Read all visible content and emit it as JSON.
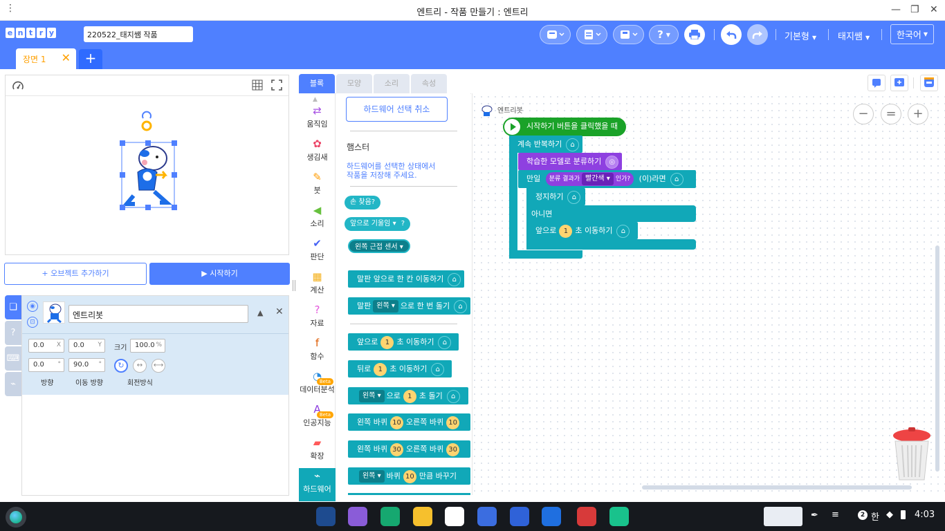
{
  "window": {
    "menu_glyph": "⋮",
    "title": "엔트리 - 작품 만들기 : 엔트리",
    "minimize": "—",
    "restore": "❐",
    "close": "✕"
  },
  "header": {
    "logo": [
      "e",
      "n",
      "t",
      "r",
      "y"
    ],
    "project_name": "220522_태지쌤 작품",
    "help": "?",
    "mode": "기본형",
    "user": "태지쌤",
    "language": "한국어",
    "scene_tab": "장면 1",
    "scene_close": "✕",
    "add_scene": "+"
  },
  "stage": {
    "add_object": "+ 오브젝트 추가하기",
    "start": "▶ 시작하기"
  },
  "object": {
    "name": "엔트리봇",
    "x": "0.0",
    "x_unit": "X",
    "y": "0.0",
    "y_unit": "Y",
    "size_label": "크기",
    "size": "100.0",
    "size_unit": "%",
    "direction": "0.0",
    "direction_unit": "°",
    "move_direction": "90.0",
    "move_direction_unit": "°",
    "direction_label": "방향",
    "move_direction_label": "이동 방향",
    "rotation_label": "회전방식"
  },
  "block_tabs": [
    "블록",
    "모양",
    "소리",
    "속성"
  ],
  "categories": [
    {
      "label": "움직임",
      "icon": "⇄",
      "color": "#a751e3"
    },
    {
      "label": "생김새",
      "icon": "✿",
      "color": "#ec4466"
    },
    {
      "label": "붓",
      "icon": "✎",
      "color": "#ff9b00"
    },
    {
      "label": "소리",
      "icon": "◀",
      "color": "#67c13e"
    },
    {
      "label": "판단",
      "icon": "✔",
      "color": "#4562f5"
    },
    {
      "label": "계산",
      "icon": "▦",
      "color": "#f4af18"
    },
    {
      "label": "자료",
      "icon": "?",
      "color": "#e457dc"
    },
    {
      "label": "함수",
      "icon": "f",
      "color": "#de5c04"
    },
    {
      "label": "데이터분석",
      "icon": "◔",
      "color": "#2b8de0",
      "beta": "Beta"
    },
    {
      "label": "인공지능",
      "icon": "A",
      "color": "#8e40e0",
      "beta": "Beta"
    },
    {
      "label": "확장",
      "icon": "▰",
      "color": "#ff5a5a"
    },
    {
      "label": "하드웨어",
      "icon": "⌁",
      "color": "#ffffff"
    }
  ],
  "palette": {
    "hw_cancel": "하드웨어 선택 취소",
    "device": "햄스터",
    "hint": "하드웨어를 선택한 상태에서 작품을 저장해 주세요.",
    "b_hand": "손 찾음?",
    "b_tilt": "앞으로 기울임",
    "b_tilt_q": "?",
    "b_prox": "왼쪽 근접 센서",
    "b_board_fwd": "말판 앞으로 한 칸 이동하기",
    "b_board_turn_pre": "말판",
    "b_board_turn_dd": "왼쪽",
    "b_board_turn_post": "으로 한 번 돌기",
    "b_fwd_pre": "앞으로",
    "b_fwd_num": "1",
    "b_fwd_post": "초 이동하기",
    "b_back_pre": "뒤로",
    "b_back_num": "1",
    "b_back_post": "초 이동하기",
    "b_turn_dd": "왼쪽",
    "b_turn_mid": "으로",
    "b_turn_num": "1",
    "b_turn_post": "초 돌기",
    "b_w1_pre": "왼쪽 바퀴",
    "b_w1_n1": "10",
    "b_w1_mid": "오른쪽 바퀴",
    "b_w1_n2": "10",
    "b_w2_pre": "왼쪽 바퀴",
    "b_w2_n1": "30",
    "b_w2_mid": "오른쪽 바퀴",
    "b_w2_n2": "30",
    "b_w3_dd": "왼쪽",
    "b_w3_mid": "바퀴",
    "b_w3_num": "10",
    "b_w3_post": "만큼 바꾸기"
  },
  "script": {
    "object_label": "엔트리봇",
    "when_start": "시작하기 버튼을 클릭했을 때",
    "repeat": "계속 반복하기",
    "classify": "학습한 모델로 분류하기",
    "if": "만일",
    "result": "분류 결과가",
    "color": "빨간색",
    "is": "인가?",
    "then": "(이)라면",
    "stop": "정지하기",
    "else": "아니면",
    "fwd_pre": "앞으로",
    "fwd_num": "1",
    "fwd_post": "초 이동하기"
  },
  "zoom": [
    "−",
    "=",
    "+"
  ],
  "tray": {
    "ime_count": "2",
    "ime": "한",
    "time": "4:03"
  },
  "colors": {
    "accent": "#4f80ff",
    "hardware": "#11a8b8",
    "start": "#1aa228",
    "ai": "#8e40e0",
    "scene": "#ffa000"
  }
}
